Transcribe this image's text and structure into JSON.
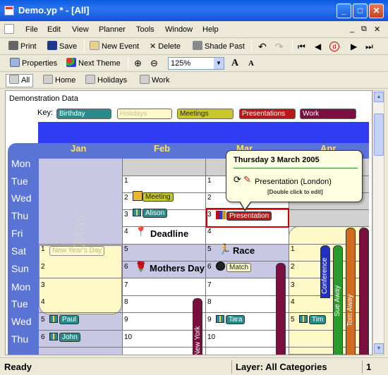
{
  "window": {
    "title": "Demo.yp * - [All]",
    "min": "_",
    "max": "□",
    "close": "✕"
  },
  "menu": {
    "items": [
      "File",
      "Edit",
      "View",
      "Planner",
      "Tools",
      "Window",
      "Help"
    ],
    "win_min": "_",
    "win_restore": "⧉",
    "win_close": "✕"
  },
  "toolbar1": {
    "print": "Print",
    "save": "Save",
    "new_event": "New Event",
    "delete": "Delete",
    "shade_past": "Shade Past"
  },
  "toolbar2": {
    "properties": "Properties",
    "next_theme": "Next Theme",
    "zoom": "125%"
  },
  "tabs": [
    "All",
    "Home",
    "Holidays",
    "Work"
  ],
  "doc": {
    "title": "Demonstration Data",
    "key_label": "Key:",
    "key": [
      {
        "label": "Birthday",
        "color": "#2a8a8a",
        "text_color": "#fff"
      },
      {
        "label": "Holidays",
        "color": "#fff9c8",
        "text_color": "#c9c090"
      },
      {
        "label": "Meetings",
        "color": "#c8c82a",
        "text_color": "#333"
      },
      {
        "label": "Presentations",
        "color": "#b81818",
        "text_color": "#fff"
      },
      {
        "label": "Work",
        "color": "#7a0e3e",
        "text_color": "#fff"
      }
    ],
    "months": [
      "Jan",
      "Feb",
      "Mar",
      "Apr"
    ],
    "days": [
      "Mon",
      "Tue",
      "Wed",
      "Thu",
      "Fri",
      "Sat",
      "Sun",
      "Mon",
      "Tue",
      "Wed",
      "Thu"
    ],
    "xmas": "XMas",
    "events": {
      "meeting": "Meeting",
      "alison": "Alison",
      "presentation": "Presentation",
      "deadline": "Deadline",
      "new_years": "New Year's Day",
      "race": "Race",
      "mothers_day": "Mothers Day",
      "match": "Match",
      "paul": "Paul",
      "tara": "Tara",
      "tim": "Tim",
      "john": "John",
      "new_york": "New York",
      "conference": "Conference",
      "sue_away": "Sue Away",
      "tom_away": "Tom Away"
    },
    "jan_nums": [
      "1",
      "2",
      "3",
      "4",
      "5",
      "6"
    ],
    "feb_nums": [
      "1",
      "2",
      "3",
      "4",
      "5",
      "6",
      "7",
      "8",
      "9",
      "10"
    ],
    "mar_nums": [
      "1",
      "2",
      "3",
      "4",
      "5",
      "6",
      "7",
      "8",
      "9",
      "10"
    ],
    "apr_nums": [
      "1",
      "2",
      "3",
      "4",
      "5"
    ],
    "callout": {
      "date": "Thursday 3 March 2005",
      "event": "Presentation (London)",
      "hint": "[Double click to edit]"
    }
  },
  "status": {
    "left": "Ready",
    "layer": "Layer: All Categories",
    "page": "1"
  }
}
